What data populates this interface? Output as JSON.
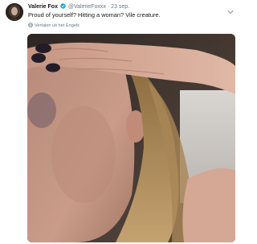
{
  "tweet": {
    "author_name": "Valerie Fox",
    "verified_icon": "verified-badge-icon",
    "handle": "@ValerieFoxxx",
    "separator": "·",
    "date": "23 sep.",
    "text": "Proud of yourself? Hitting a woman? Vile creature.",
    "translate_label": "Vertalen uit het Engels",
    "translate_icon": "globe-icon",
    "menu_icon": "chevron-down-icon",
    "media_alt": "photo"
  },
  "colors": {
    "text": "#14171a",
    "secondary": "#657786",
    "verified": "#1da1f2"
  }
}
